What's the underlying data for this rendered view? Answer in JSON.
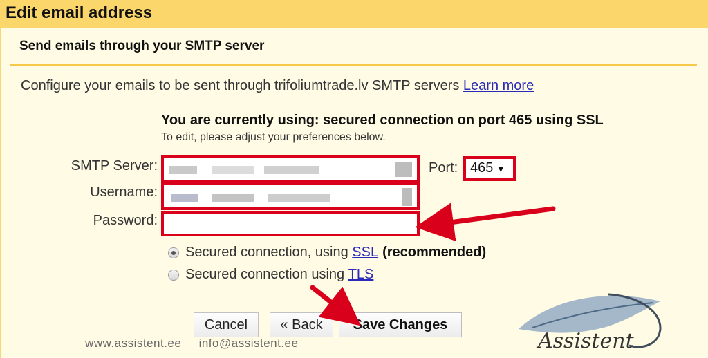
{
  "dialog": {
    "title": "Edit email address",
    "subtitle": "Send emails through your SMTP server",
    "description": "Configure your emails to be sent through trifoliumtrade.lv SMTP servers",
    "learn_more": "Learn more",
    "status": "You are currently using: secured connection on port 465 using SSL",
    "hint": "To edit, please adjust your preferences below."
  },
  "form": {
    "smtp_label": "SMTP Server:",
    "username_label": "Username:",
    "password_label": "Password:",
    "port_label": "Port:",
    "port_value": "465",
    "password_value": ""
  },
  "security": {
    "ssl_prefix": "Secured connection, using",
    "ssl_link": "SSL",
    "ssl_recommended": "(recommended)",
    "tls_prefix": "Secured connection using",
    "tls_link": "TLS",
    "selected": "ssl"
  },
  "buttons": {
    "cancel": "Cancel",
    "back": "« Back",
    "save": "Save Changes"
  },
  "footer": {
    "website": "www.assistent.ee",
    "email": "info@assistent.ee"
  },
  "logo": {
    "text": "Assistent"
  },
  "colors": {
    "highlight": "#d9001b",
    "title_bar": "#fbd66b",
    "panel": "#fffbe4",
    "rule": "#f6c94a",
    "link": "#2a2ab8"
  }
}
